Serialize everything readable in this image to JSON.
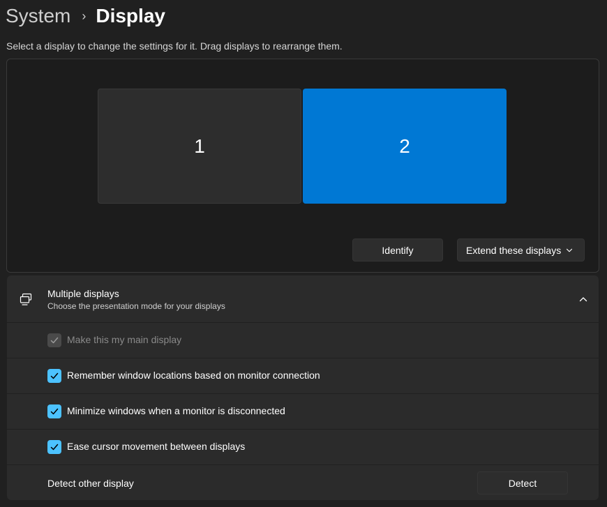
{
  "breadcrumb": {
    "parent": "System",
    "separator": "›",
    "current": "Display"
  },
  "instructions": "Select a display to change the settings for it. Drag displays to rearrange them.",
  "displays": [
    {
      "label": "1",
      "selected": false
    },
    {
      "label": "2",
      "selected": true
    }
  ],
  "buttons": {
    "identify": "Identify",
    "extend_mode": "Extend these displays",
    "detect": "Detect"
  },
  "multiple_displays": {
    "title": "Multiple displays",
    "subtitle": "Choose the presentation mode for your displays",
    "options": [
      {
        "label": "Make this my main display",
        "checked": true,
        "disabled": true
      },
      {
        "label": "Remember window locations based on monitor connection",
        "checked": true,
        "disabled": false
      },
      {
        "label": "Minimize windows when a monitor is disconnected",
        "checked": true,
        "disabled": false
      },
      {
        "label": "Ease cursor movement between displays",
        "checked": true,
        "disabled": false
      }
    ],
    "detect_label": "Detect other display"
  },
  "colors": {
    "accent": "#0078d4",
    "checkbox": "#4cc2ff",
    "background": "#202020",
    "card": "#2b2b2b"
  },
  "icons": [
    "chevron-right-icon",
    "chevron-down-icon",
    "multiple-displays-icon",
    "chevron-up-icon",
    "checkmark-icon"
  ]
}
